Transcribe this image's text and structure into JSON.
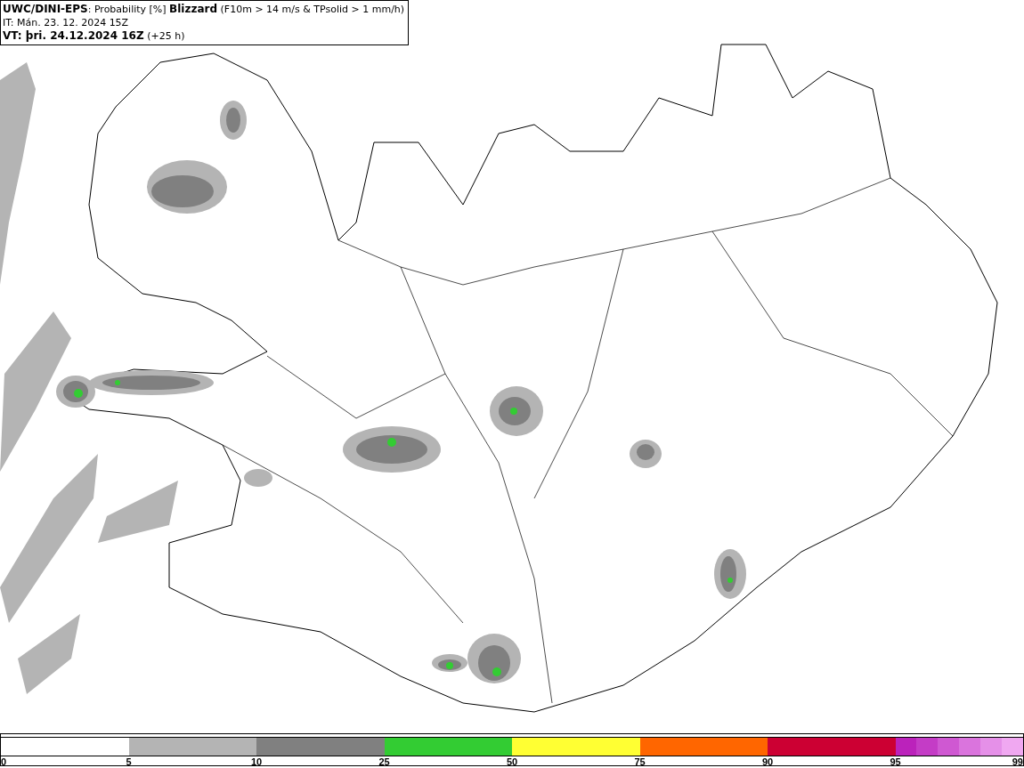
{
  "header": {
    "title": "**UWC/DINI-EPS**: Probability [%] **Blizzard** (F10m > 14 m/s & TPsolid > 1 mm/h)",
    "initial_time": "IT: Mán. 23. 12. 2024 15Z",
    "valid_time": "**VT: þri. 24.12.2024 16Z** (+25 h)"
  },
  "legend": {
    "bins": [
      {
        "color": "#b4b4b4"
      },
      {
        "color": "#808080"
      },
      {
        "color": "#33cc33"
      },
      {
        "color": "#ffff33"
      },
      {
        "color": "#ff6600"
      },
      {
        "color": "#cc0033"
      },
      {
        "stops": [
          {
            "color": "#bb22bb"
          },
          {
            "color": "#c43cc6"
          },
          {
            "color": "#cf58d2"
          },
          {
            "color": "#da74dd"
          },
          {
            "color": "#e590e8"
          },
          {
            "color": "#f0a8f1"
          }
        ]
      }
    ],
    "labels": [
      "0",
      "5",
      "10",
      "25",
      "50",
      "75",
      "90",
      "95",
      "99"
    ]
  }
}
